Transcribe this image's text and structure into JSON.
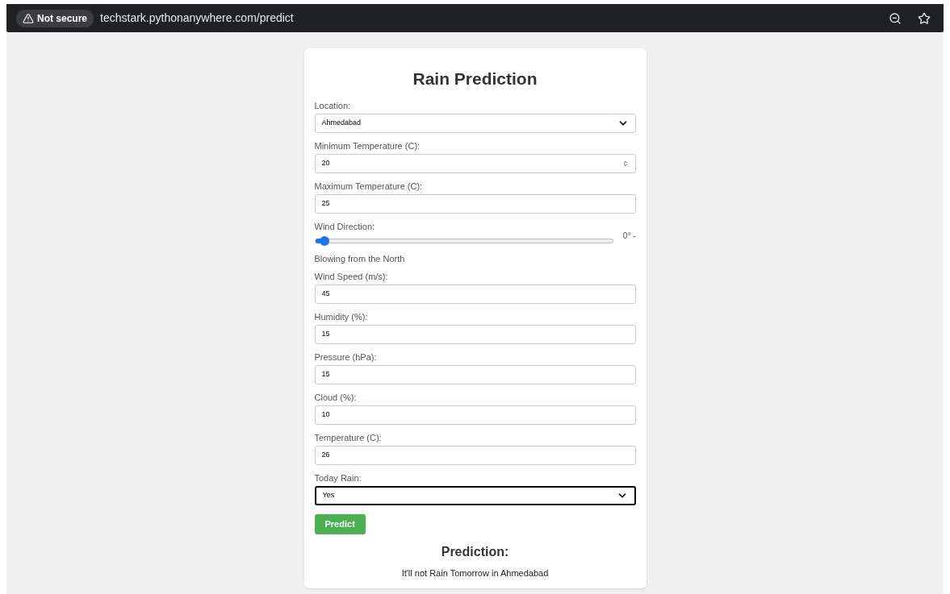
{
  "browser": {
    "security_badge": "Not secure",
    "url": "techstark.pythonanywhere.com/predict"
  },
  "form": {
    "title": "Rain Prediction",
    "fields": [
      {
        "kind": "select",
        "label": "Location:",
        "value": "Ahmedabad",
        "focused": false
      },
      {
        "kind": "number",
        "label": "Minimum Temperature (C):",
        "value": "20",
        "focused": false
      },
      {
        "kind": "text",
        "label": "Maximum Temperature (C):",
        "value": "25",
        "focused": false
      },
      {
        "kind": "slider",
        "label": "Wind Direction:",
        "level": 0.02,
        "reading": "0° -",
        "description": "Blowing from the North"
      },
      {
        "kind": "text",
        "label": "Wind Speed (m/s):",
        "value": "45",
        "focused": false
      },
      {
        "kind": "text",
        "label": "Humidity (%):",
        "value": "15",
        "focused": false
      },
      {
        "kind": "text",
        "label": "Pressure (hPa):",
        "value": "15",
        "focused": false
      },
      {
        "kind": "text",
        "label": "Cloud (%):",
        "value": "10",
        "focused": false
      },
      {
        "kind": "text",
        "label": "Temperature (C):",
        "value": "26",
        "focused": false
      },
      {
        "kind": "select",
        "label": "Today Rain:",
        "value": "Yes",
        "focused": true
      }
    ],
    "submit": "Predict",
    "result_heading": "Prediction:",
    "result_text": "It'll not Rain Tomorrow in Ahmedabad"
  }
}
